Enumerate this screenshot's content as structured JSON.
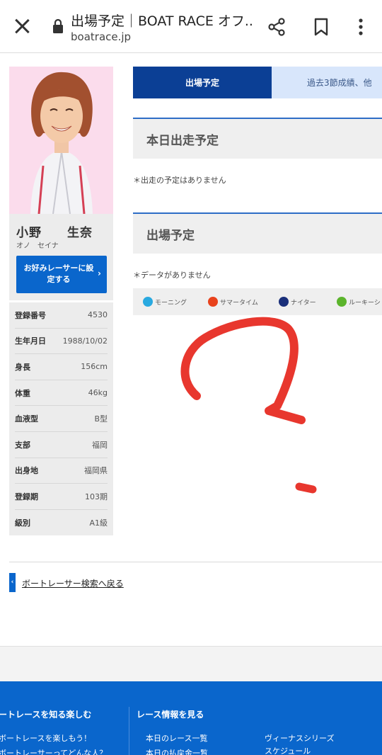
{
  "browser": {
    "title": "出場予定｜BOAT RACE オフ...",
    "url": "boatrace.jp"
  },
  "racer": {
    "name": "小野　　生奈",
    "kana": "オノ　セイナ",
    "favorite_button": "お好みレーサーに設定する",
    "info": [
      {
        "key": "登録番号",
        "value": "4530"
      },
      {
        "key": "生年月日",
        "value": "1988/10/02"
      },
      {
        "key": "身長",
        "value": "156cm"
      },
      {
        "key": "体重",
        "value": "46kg"
      },
      {
        "key": "血液型",
        "value": "B型"
      },
      {
        "key": "支部",
        "value": "福岡"
      },
      {
        "key": "出身地",
        "value": "福岡県"
      },
      {
        "key": "登録期",
        "value": "103期"
      },
      {
        "key": "級別",
        "value": "A1級"
      }
    ]
  },
  "tabs": [
    {
      "label": "出場予定",
      "active": true
    },
    {
      "label": "過去3節成績、他",
      "active": false
    }
  ],
  "sections": {
    "today": {
      "title": "本日出走予定",
      "note": "＊出走の予定はありません"
    },
    "schedule": {
      "title": "出場予定",
      "note": "＊データがありません"
    }
  },
  "legend": [
    {
      "label": "モーニング",
      "icon": "morning-icon",
      "color": "#29a9e0"
    },
    {
      "label": "サマータイム",
      "icon": "summertime-icon",
      "color": "#e8421c"
    },
    {
      "label": "ナイター",
      "icon": "nighter-icon",
      "color": "#1a2f7a"
    },
    {
      "label": "ルーキーシ",
      "icon": "rookie-icon",
      "color": "#5bb42c"
    }
  ],
  "back_link": "ボートレーサー検索へ戻る",
  "footer": {
    "col1_heading": "ートレースを知る楽しむ",
    "col1_links": [
      "ボートレースを楽しもう！",
      "ボートレーサーってどんな人？"
    ],
    "col2_heading": "レース情報を見る",
    "col2_links": [
      "本日のレース一覧",
      "本日の払戻金一覧"
    ],
    "col3_links": [
      "ヴィーナスシリーズ",
      "スケジュール"
    ]
  },
  "colors": {
    "brand_blue": "#0a66cc",
    "tab_active": "#0b3f95",
    "tab_inactive": "#d8e6fb",
    "scribble": "#e8372e"
  }
}
